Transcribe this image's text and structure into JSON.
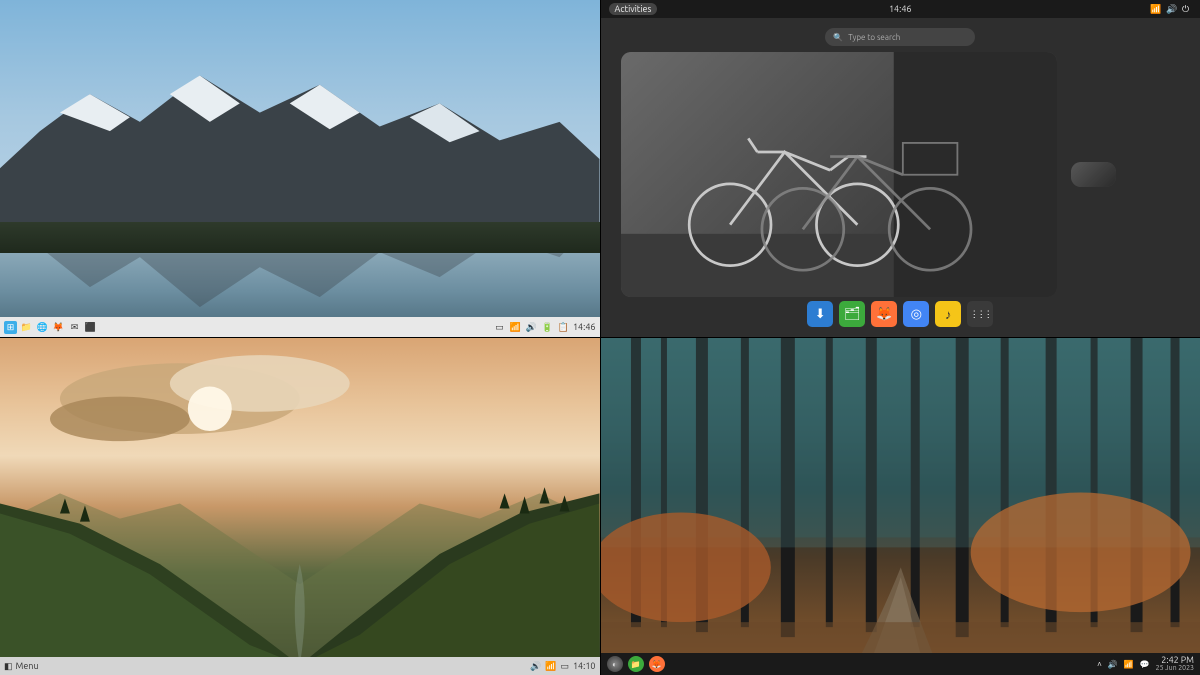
{
  "tl": {
    "panel": {
      "apps_icon": "apps",
      "tray": [
        "network",
        "volume",
        "battery",
        "clipboard"
      ],
      "time": "14:46"
    },
    "launch_icons": [
      "files-icon",
      "browser-icon",
      "firefox-icon",
      "mail-icon",
      "terminal-icon"
    ]
  },
  "tr": {
    "topbar": {
      "activities": "Activities",
      "time": "14:46",
      "sys": [
        "network-icon",
        "volume-icon",
        "power-icon"
      ]
    },
    "search_placeholder": "Type to search",
    "dash": [
      {
        "name": "downloads-icon",
        "bg": "#2d7dd2",
        "glyph": "⬇"
      },
      {
        "name": "files-icon",
        "bg": "#3caa3c",
        "glyph": "🗂"
      },
      {
        "name": "firefox-icon",
        "bg": "#ff7139",
        "glyph": "🦊"
      },
      {
        "name": "chromium-icon",
        "bg": "#4285f4",
        "glyph": "◎"
      },
      {
        "name": "music-icon",
        "bg": "#f5c518",
        "glyph": "♪"
      },
      {
        "name": "apps-grid-icon",
        "bg": "#3a3a3a",
        "glyph": "⋮⋮⋮"
      }
    ]
  },
  "bl": {
    "panel": {
      "menu_label": "Menu",
      "tray": [
        "volume-icon",
        "network-icon"
      ],
      "time": "14:10"
    }
  },
  "br": {
    "panel": {
      "launchers": [
        {
          "name": "distro-logo-icon",
          "bg": "#4a4a4a",
          "glyph": "◐"
        },
        {
          "name": "files-icon",
          "bg": "#3caa3c",
          "glyph": "📁"
        },
        {
          "name": "firefox-icon",
          "bg": "#ff7139",
          "glyph": "🦊"
        }
      ],
      "tray": [
        "chevron-up-icon",
        "volume-icon",
        "network-icon",
        "notifications-icon"
      ],
      "time": "2:42 PM",
      "date": "25 Jun 2023"
    }
  }
}
